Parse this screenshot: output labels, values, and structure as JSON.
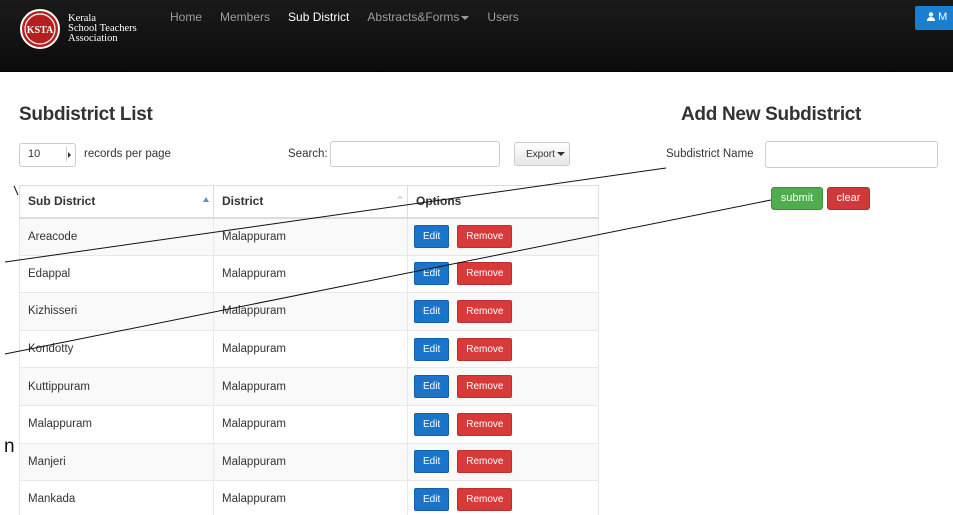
{
  "navbar": {
    "brand": {
      "line1": "Kerala",
      "line2": "School Teachers",
      "line3": "Association",
      "logo_text": "KSTA"
    },
    "links": [
      {
        "label": "Home",
        "active": false
      },
      {
        "label": "Members",
        "active": false
      },
      {
        "label": "Sub District",
        "active": true
      },
      {
        "label": "Abstracts&Forms",
        "active": false,
        "dropdown": true
      },
      {
        "label": "Users",
        "active": false
      }
    ],
    "user_button_label": "M",
    "user_icon": "user-icon"
  },
  "list": {
    "title": "Subdistrict List",
    "per_page_value": "10",
    "per_page_label": "records per page",
    "search_label": "Search:",
    "search_value": "",
    "export_label": "Export",
    "columns": [
      "Sub District",
      "District",
      "Options"
    ],
    "rows": [
      {
        "sub_district": "Areacode",
        "district": "Malappuram"
      },
      {
        "sub_district": "Edappal",
        "district": "Malappuram"
      },
      {
        "sub_district": "Kizhisseri",
        "district": "Malappuram"
      },
      {
        "sub_district": "Kondotty",
        "district": "Malappuram"
      },
      {
        "sub_district": "Kuttippuram",
        "district": "Malappuram"
      },
      {
        "sub_district": "Malappuram",
        "district": "Malappuram"
      },
      {
        "sub_district": "Manjeri",
        "district": "Malappuram"
      },
      {
        "sub_district": "Mankada",
        "district": "Malappuram"
      }
    ],
    "edit_label": "Edit",
    "remove_label": "Remove"
  },
  "form": {
    "title": "Add New Subdistrict",
    "field_label": "Subdistrict Name",
    "field_value": "",
    "submit_label": "submit",
    "clear_label": "clear"
  },
  "annotation": {
    "side_char": "n"
  },
  "colors": {
    "navbar_bg": "#111111",
    "edit_blue": "#1a74c9",
    "remove_red": "#d83a3a",
    "submit_green": "#4eae4e",
    "clear_red": "#d0393a"
  }
}
